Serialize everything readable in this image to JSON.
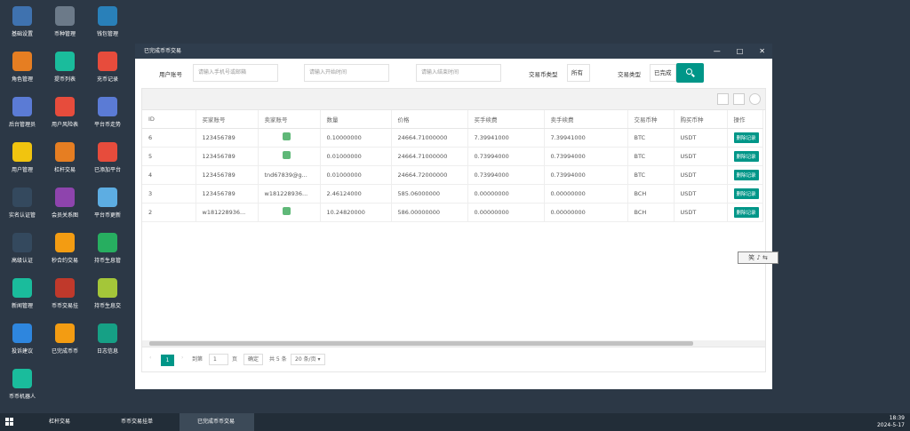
{
  "desktop_icons": [
    {
      "label": "基础设置",
      "icon": "gear-icon",
      "color": "#3f72af"
    },
    {
      "label": "币种管理",
      "icon": "dollar-icon",
      "color": "#6c7a89"
    },
    {
      "label": "钱包管理",
      "icon": "wallet-icon",
      "color": "#2980b9"
    },
    {
      "label": "角色管理",
      "icon": "role-icon",
      "color": "#e67e22"
    },
    {
      "label": "提币列表",
      "icon": "coin-list-icon",
      "color": "#1abc9c"
    },
    {
      "label": "充币记录",
      "icon": "chart-icon",
      "color": "#e74c3c"
    },
    {
      "label": "后台管理员",
      "icon": "admin-icon",
      "color": "#5b7bd5"
    },
    {
      "label": "用户风险表",
      "icon": "alarm-icon",
      "color": "#e74c3c"
    },
    {
      "label": "平台币走势",
      "icon": "layers-icon",
      "color": "#5b7bd5"
    },
    {
      "label": "用户管理",
      "icon": "user-icon",
      "color": "#f1c40f"
    },
    {
      "label": "杠杆交易",
      "icon": "stack-icon",
      "color": "#e67e22"
    },
    {
      "label": "已添加平台",
      "icon": "trend-icon",
      "color": "#e74c3c"
    },
    {
      "label": "实名认证管",
      "icon": "verify-icon",
      "color": "#34495e"
    },
    {
      "label": "会员关系图",
      "icon": "share-icon",
      "color": "#8e44ad"
    },
    {
      "label": "平台币更新",
      "icon": "cloud-icon",
      "color": "#5dade2"
    },
    {
      "label": "高级认证",
      "icon": "senior-icon",
      "color": "#34495e"
    },
    {
      "label": "秒合约交易",
      "icon": "timer-icon",
      "color": "#f39c12"
    },
    {
      "label": "持币生息管",
      "icon": "lock-icon",
      "color": "#27ae60"
    },
    {
      "label": "新闻管理",
      "icon": "news-icon",
      "color": "#1abc9c"
    },
    {
      "label": "币币交易挂",
      "icon": "b-icon",
      "color": "#c0392b"
    },
    {
      "label": "持币生息交",
      "icon": "hammer-icon",
      "color": "#a4c639"
    },
    {
      "label": "投诉建议",
      "icon": "mail-icon",
      "color": "#2e86de"
    },
    {
      "label": "已完成币币",
      "icon": "check-icon",
      "color": "#f39c12"
    },
    {
      "label": "日志信息",
      "icon": "log-icon",
      "color": "#16a085"
    },
    {
      "label": "币币机器人",
      "icon": "robot-icon",
      "color": "#1abc9c"
    }
  ],
  "window": {
    "title": "已完成币币交易",
    "min": "—",
    "max": "□",
    "close": "✕"
  },
  "filter": {
    "user_label": "用户账号",
    "user_placeholder": "请输入手机号或邮箱",
    "start_placeholder": "请输入开始时间",
    "end_placeholder": "请输入结束时间",
    "coin_type_label": "交易币类型",
    "coin_type_value": "所有",
    "trade_type_label": "交易类型",
    "trade_type_value": "已完成"
  },
  "table": {
    "headers": [
      "ID",
      "买家账号",
      "卖家账号",
      "数量",
      "价格",
      "买手续费",
      "卖手续费",
      "交易币种",
      "购买币种",
      "操作"
    ],
    "rows": [
      {
        "id": "6",
        "buyer": "123456789",
        "seller": "",
        "qty": "0.10000000",
        "price": "24664.71000000",
        "buy_fee": "7.39941000",
        "sell_fee": "7.39941000",
        "coin": "BTC",
        "buy_coin": "USDT",
        "action": "删除记录"
      },
      {
        "id": "5",
        "buyer": "123456789",
        "seller": "",
        "qty": "0.01000000",
        "price": "24664.71000000",
        "buy_fee": "0.73994000",
        "sell_fee": "0.73994000",
        "coin": "BTC",
        "buy_coin": "USDT",
        "action": "删除记录"
      },
      {
        "id": "4",
        "buyer": "123456789",
        "seller": "tnd67839@g...",
        "qty": "0.01000000",
        "price": "24664.72000000",
        "buy_fee": "0.73994000",
        "sell_fee": "0.73994000",
        "coin": "BTC",
        "buy_coin": "USDT",
        "action": "删除记录"
      },
      {
        "id": "3",
        "buyer": "123456789",
        "seller": "w181228936...",
        "qty": "2.46124000",
        "price": "585.06000000",
        "buy_fee": "0.00000000",
        "sell_fee": "0.00000000",
        "coin": "BCH",
        "buy_coin": "USDT",
        "action": "删除记录"
      },
      {
        "id": "2",
        "buyer": "w181228936...",
        "seller": "",
        "qty": "10.24820000",
        "price": "586.00000000",
        "buy_fee": "0.00000000",
        "sell_fee": "0.00000000",
        "coin": "BCH",
        "buy_coin": "USDT",
        "action": "删除记录"
      }
    ]
  },
  "pager": {
    "current": "1",
    "goto_label": "到第",
    "goto_value": "1",
    "page_unit": "页",
    "confirm": "确定",
    "total": "共 5 条",
    "page_size": "20 条/页"
  },
  "floating": {
    "text": "笑 ♪ ⇆"
  },
  "taskbar": {
    "tasks": [
      "杠杆交易",
      "币币交易挂单",
      "已完成币币交易"
    ],
    "time": "18:39",
    "date": "2024-5-17"
  }
}
